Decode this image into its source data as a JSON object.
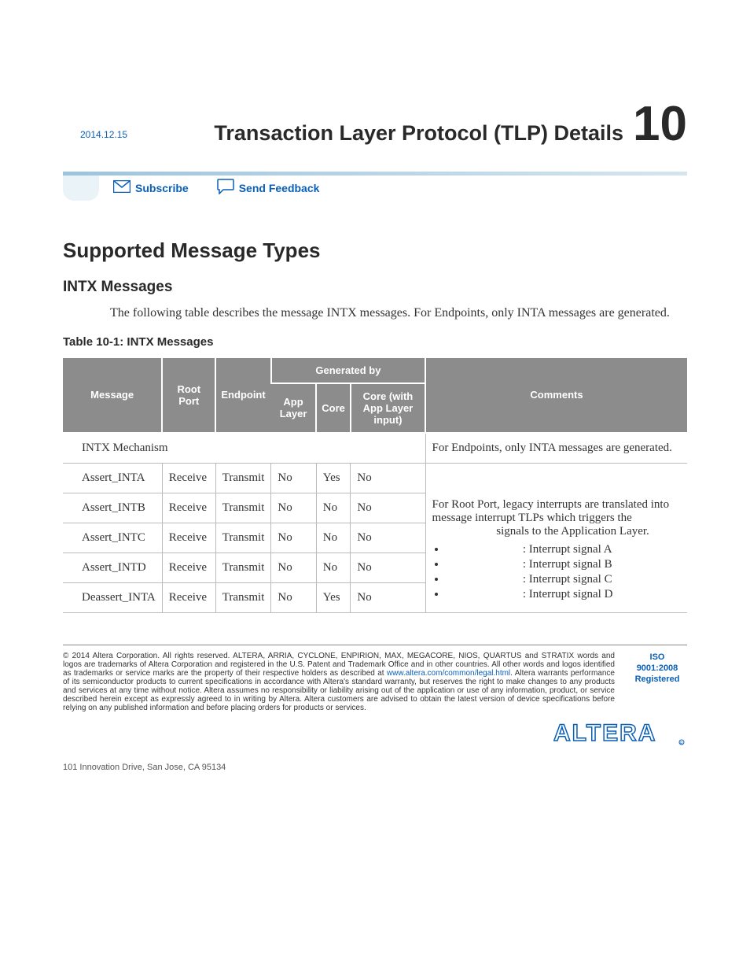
{
  "chapter": {
    "title": "Transaction Layer Protocol (TLP) Details",
    "number": "10"
  },
  "date": "2014.12.15",
  "actions": {
    "subscribe": "Subscribe",
    "feedback": "Send Feedback"
  },
  "sections": {
    "h1": "Supported Message Types",
    "h2": "INTX Messages",
    "intro": "The following table describes the message INTX messages. For Endpoints, only INTA messages are generated.",
    "table_caption": "Table 10-1: INTX Messages"
  },
  "table": {
    "headers": {
      "message": "Message",
      "root_port": "Root Port",
      "endpoint": "Endpoint",
      "generated_by": "Generated by",
      "app_layer": "App Layer",
      "core": "Core",
      "core_with": "Core (with App Layer input)",
      "comments": "Comments"
    },
    "section_row": {
      "left": "INTX Mechanism",
      "right": "For Endpoints, only INTA messages are generated."
    },
    "rows": [
      {
        "msg": "Assert_INTA",
        "rp": "Receive",
        "ep": "Transmit",
        "al": "No",
        "c": "Yes",
        "cw": "No"
      },
      {
        "msg": "Assert_INTB",
        "rp": "Receive",
        "ep": "Transmit",
        "al": "No",
        "c": "No",
        "cw": "No"
      },
      {
        "msg": "Assert_INTC",
        "rp": "Receive",
        "ep": "Transmit",
        "al": "No",
        "c": "No",
        "cw": "No"
      },
      {
        "msg": "Assert_INTD",
        "rp": "Receive",
        "ep": "Transmit",
        "al": "No",
        "c": "No",
        "cw": "No"
      },
      {
        "msg": "Deassert_INTA",
        "rp": "Receive",
        "ep": "Transmit",
        "al": "No",
        "c": "Yes",
        "cw": "No"
      }
    ],
    "comments_block": {
      "p1a": "For Root Port, legacy interrupts are translated into message interrupt TLPs which triggers the ",
      "p1b": " signals to the Application Layer.",
      "sigA": ": Interrupt signal A",
      "sigB": ": Interrupt signal B",
      "sigC": ": Interrupt signal C",
      "sigD": ": Interrupt signal D"
    }
  },
  "footer": {
    "copyright_symbol": "©",
    "copy_a": " 2014 Altera Corporation. All rights reserved. ALTERA, ARRIA, CYCLONE, ENPIRION, MAX, MEGACORE, NIOS, QUARTUS and STRATIX words and logos are trademarks of Altera Corporation and registered in the U.S. Patent and Trademark Office and in other countries. All other words and logos identified as trademarks or service marks are the property of their respective holders as described at ",
    "legal_link": "www.altera.com/common/legal.html",
    "copy_b": ". Altera warrants performance of its semiconductor products to current specifications in accordance with Altera's standard warranty, but reserves the right to make changes to any products and services at any time without notice. Altera assumes no responsibility or liability arising out of the application or use of any information, product, or service described herein except as expressly agreed to in writing by Altera. Altera customers are advised to obtain the latest version of device specifications before relying on any published information and before placing orders for products or services.",
    "iso1": "ISO",
    "iso2": "9001:2008",
    "iso3": "Registered",
    "address": "101 Innovation Drive, San Jose, CA 95134",
    "logo_text": "ALTERA"
  }
}
